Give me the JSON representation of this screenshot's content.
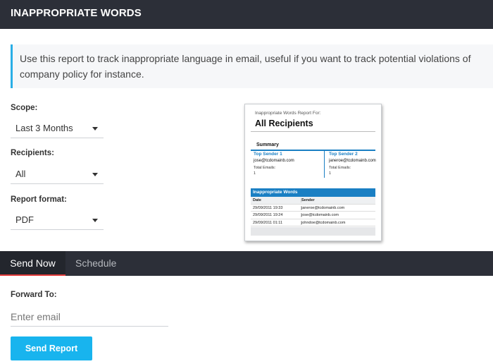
{
  "header": {
    "title": "INAPPROPRIATE WORDS"
  },
  "info": {
    "text": "Use this report to track inappropriate language in email, useful if you want to track potential violations of company policy for instance."
  },
  "fields": {
    "scope": {
      "label": "Scope:",
      "value": "Last 3 Months"
    },
    "recipients": {
      "label": "Recipients:",
      "value": "All"
    },
    "format": {
      "label": "Report format:",
      "value": "PDF"
    }
  },
  "preview": {
    "for_label": "Inappropriate Words Report For:",
    "title": "All Recipients",
    "summary": "Summary",
    "sender1": {
      "heading": "Top Sender 1",
      "email": "jose@tcdomainb.com",
      "total_label": "Total Emails:",
      "total": "1"
    },
    "sender2": {
      "heading": "Top Sender 2",
      "email": "janeroe@tcdomainb.com",
      "total_label": "Total Emails:",
      "total": "1"
    },
    "section": "Inappropriate Words",
    "table": {
      "headers": [
        "Date",
        "Sender"
      ],
      "rows": [
        [
          "29/09/2011 19:33",
          "janeroe@tcdomainb.com"
        ],
        [
          "29/09/2011 19:24",
          "jose@tcdomainb.com"
        ],
        [
          "29/09/2011 01:11",
          "johndoe@tcdomainb.com"
        ]
      ]
    }
  },
  "tabs": {
    "send_now": "Send Now",
    "schedule": "Schedule"
  },
  "forward": {
    "label": "Forward To:",
    "placeholder": "Enter email"
  },
  "send_button": "Send Report",
  "colors": {
    "header_bg": "#2c2f38",
    "accent": "#29aee6",
    "button": "#18b4ee",
    "tab_underline": "#e23a3a",
    "preview_blue": "#1a7fc3"
  }
}
